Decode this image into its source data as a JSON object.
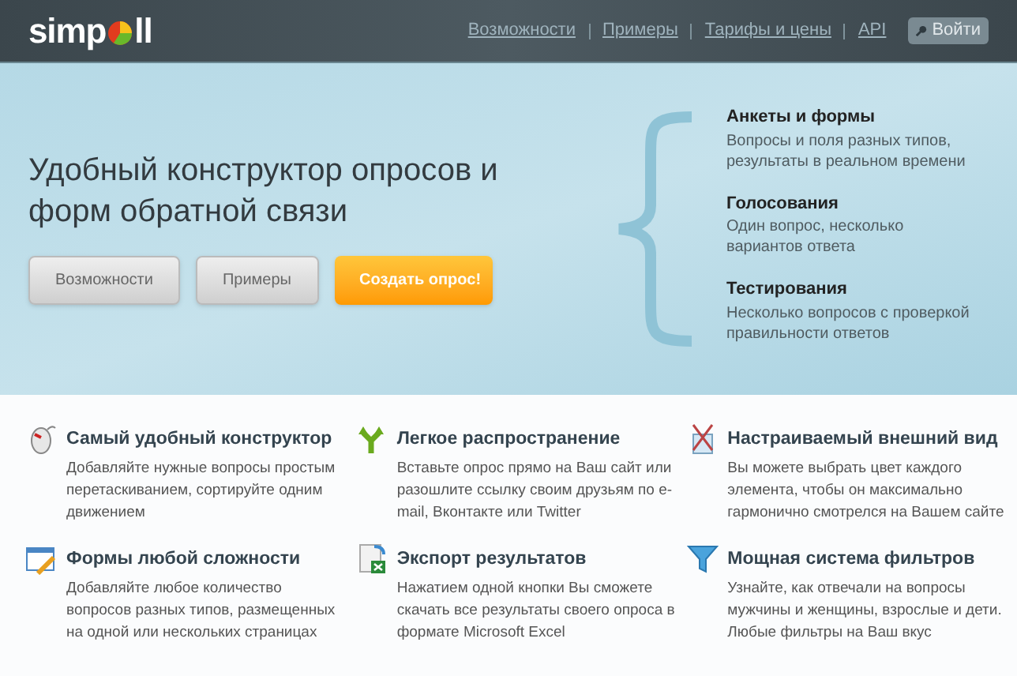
{
  "header": {
    "logo_before": "simp",
    "logo_after": "ll",
    "nav": [
      "Возможности",
      "Примеры",
      "Тарифы и цены",
      "API"
    ],
    "login": "Войти"
  },
  "hero": {
    "title": "Удобный конструктор опросов и форм обратной связи",
    "buttons": [
      {
        "label": "Возможности",
        "kind": "secondary"
      },
      {
        "label": "Примеры",
        "kind": "secondary"
      },
      {
        "label": "Создать опрос!",
        "kind": "primary"
      }
    ],
    "types": [
      {
        "title": "Анкеты и формы",
        "text": "Вопросы и поля разных типов, результаты в реальном времени"
      },
      {
        "title": "Голосования",
        "text": "Один вопрос, несколько вариантов ответа"
      },
      {
        "title": "Тестирования",
        "text": "Несколько вопросов с проверкой правильности ответов"
      }
    ]
  },
  "features": [
    {
      "kind": "mouse",
      "title": "Самый удобный конструктор",
      "text": "Добавляйте нужные вопросы простым перетаскиванием, сортируйте одним движением"
    },
    {
      "kind": "arrows",
      "title": "Легкое распространение",
      "text": "Вставьте опрос прямо на Ваш сайт или разошлите ссылку своим друзьям по e-mail, Вконтакте или Twitter"
    },
    {
      "kind": "brushes",
      "title": "Настраиваемый внешний вид",
      "text": "Вы можете выбрать цвет каждого элемента, чтобы он максимально гармонично смотрелся на Вашем сайте"
    },
    {
      "kind": "form",
      "title": "Формы любой сложности",
      "text": "Добавляйте любое количество вопросов разных типов, размещенных на одной или нескольких страницах"
    },
    {
      "kind": "excel",
      "title": "Экспорт результатов",
      "text": "Нажатием одной кнопки Вы сможете скачать все результаты своего опроса в формате Microsoft Excel"
    },
    {
      "kind": "funnel",
      "title": "Мощная система фильтров",
      "text": "Узнайте, как отвечали на вопросы мужчины и женщины, взрослые и дети. Любые фильтры на Ваш вкус"
    }
  ]
}
